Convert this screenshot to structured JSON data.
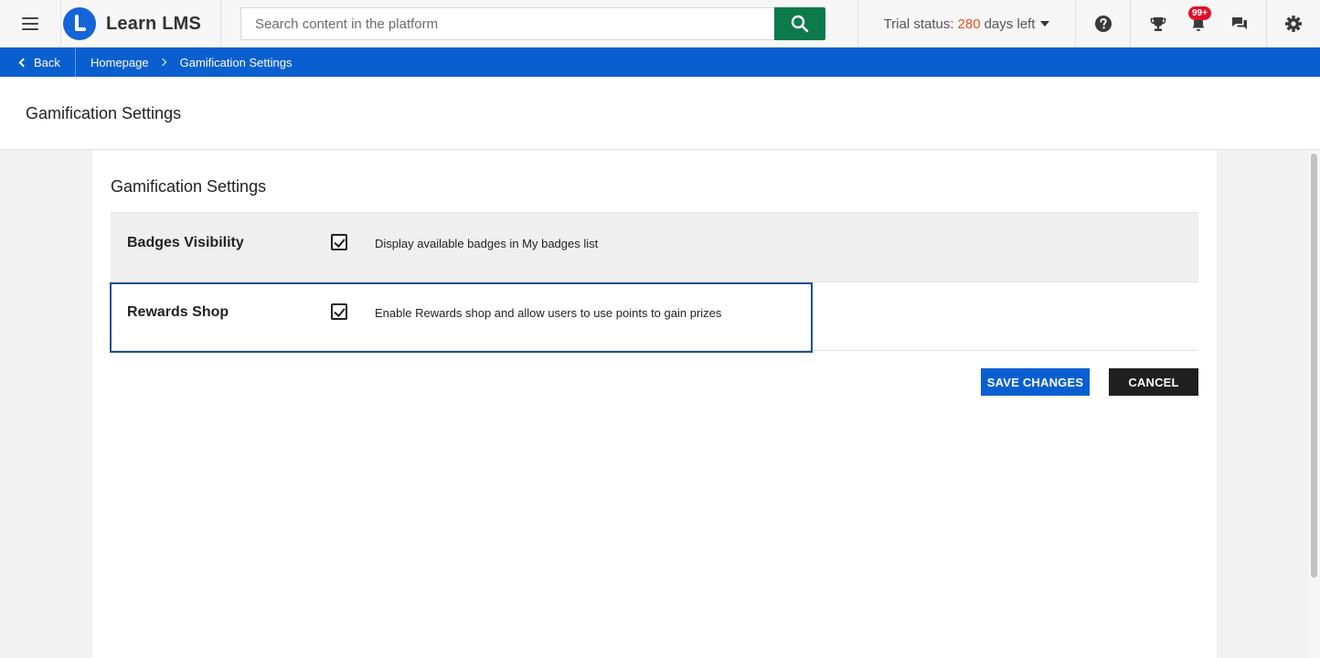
{
  "header": {
    "brand_name": "Learn LMS",
    "search_placeholder": "Search content in the platform",
    "trial_prefix": "Trial status:",
    "trial_days": "280",
    "trial_suffix": "days left",
    "notifications_badge": "99+"
  },
  "breadcrumb": {
    "back_label": "Back",
    "items": [
      "Homepage",
      "Gamification Settings"
    ]
  },
  "page": {
    "title": "Gamification Settings"
  },
  "card": {
    "title": "Gamification Settings",
    "rows": [
      {
        "label": "Badges Visibility",
        "checked": true,
        "description": "Display available badges in My badges list"
      },
      {
        "label": "Rewards Shop",
        "checked": true,
        "description": "Enable Rewards shop and allow users to use points to gain prizes"
      }
    ],
    "save_label": "SAVE CHANGES",
    "cancel_label": "CANCEL"
  },
  "colors": {
    "brand_blue": "#0a5fd0",
    "search_green": "#0c7a4b",
    "trial_accent": "#e2541b",
    "badge_red": "#e0102d"
  },
  "icons": [
    "menu-icon",
    "logo-icon",
    "search-icon",
    "chevron-down-icon",
    "help-icon",
    "trophy-icon",
    "bell-icon",
    "chat-icon",
    "gear-icon",
    "chevron-left-icon",
    "chevron-right-icon",
    "checkbox-checked-icon"
  ]
}
